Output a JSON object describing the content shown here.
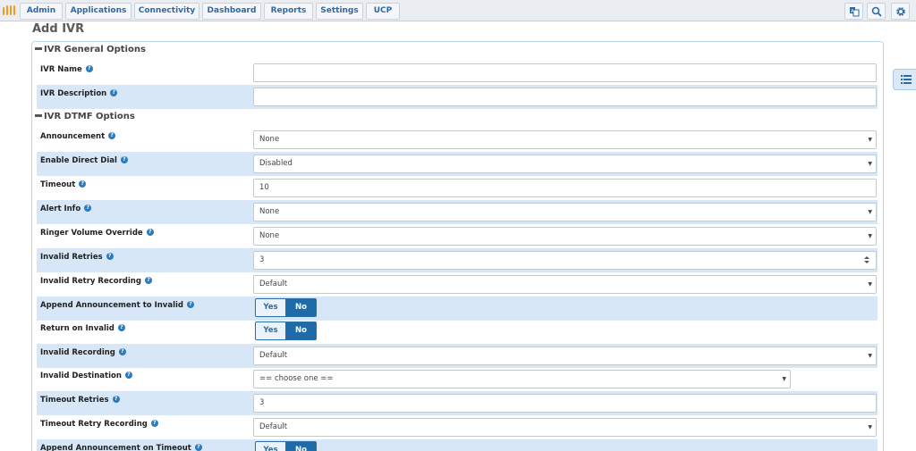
{
  "nav": {
    "items": [
      "Admin",
      "Applications",
      "Connectivity",
      "Dashboard",
      "Reports",
      "Settings",
      "UCP"
    ],
    "right_icons": [
      "language-icon",
      "search-icon",
      "gear-icon"
    ]
  },
  "page": {
    "title": "Add IVR"
  },
  "sections": {
    "general": "IVR General Options",
    "dtmf": "IVR DTMF Options"
  },
  "rows": [
    {
      "label": "IVR Name",
      "type": "text",
      "value": ""
    },
    {
      "label": "IVR Description",
      "type": "text",
      "value": ""
    },
    {
      "label": "Announcement",
      "type": "select",
      "value": "None"
    },
    {
      "label": "Enable Direct Dial",
      "type": "select",
      "value": "Disabled"
    },
    {
      "label": "Timeout",
      "type": "text",
      "value": "10"
    },
    {
      "label": "Alert Info",
      "type": "select",
      "value": "None"
    },
    {
      "label": "Ringer Volume Override",
      "type": "select",
      "value": "None"
    },
    {
      "label": "Invalid Retries",
      "type": "number",
      "value": "3"
    },
    {
      "label": "Invalid Retry Recording",
      "type": "select",
      "value": "Default"
    },
    {
      "label": "Append Announcement to Invalid",
      "type": "toggle",
      "yes": "Yes",
      "no": "No",
      "selected": "No"
    },
    {
      "label": "Return on Invalid",
      "type": "toggle",
      "yes": "Yes",
      "no": "No",
      "selected": "No"
    },
    {
      "label": "Invalid Recording",
      "type": "select",
      "value": "Default"
    },
    {
      "label": "Invalid Destination",
      "type": "select",
      "value": "== choose one =="
    },
    {
      "label": "Timeout Retries",
      "type": "text",
      "value": "3"
    },
    {
      "label": "Timeout Retry Recording",
      "type": "select",
      "value": "Default"
    },
    {
      "label": "Append Announcement on Timeout",
      "type": "toggle",
      "yes": "Yes",
      "no": "No",
      "selected": "No"
    }
  ],
  "help_glyph": "?",
  "caret_glyph": "▼",
  "colors": {
    "accent": "#1f6aa8",
    "row_alt": "#d7e7f7",
    "nav_text": "#2e6aa4",
    "logo": "#f39a1f"
  }
}
